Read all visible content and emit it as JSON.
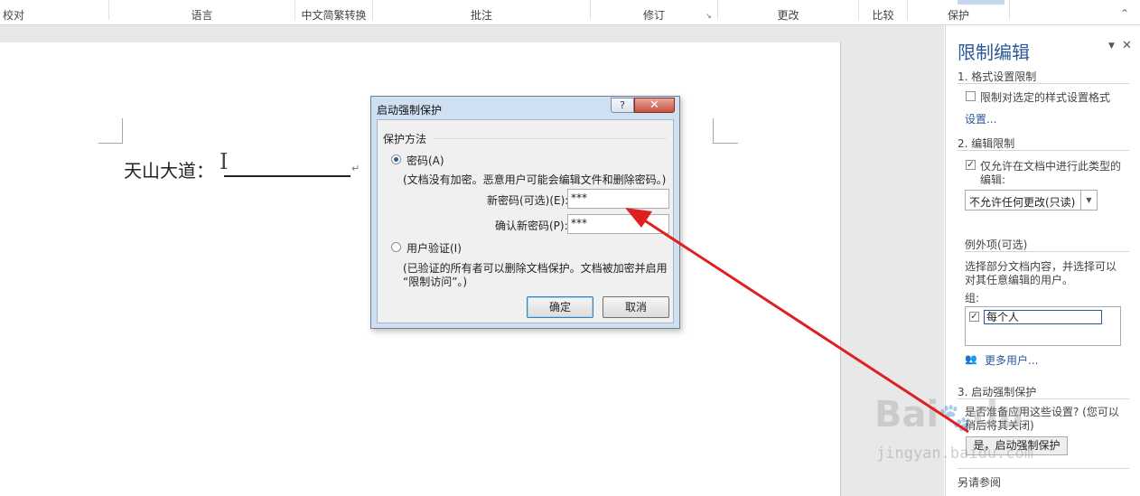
{
  "ribbon": {
    "groups": [
      "校对",
      "语言",
      "中文简繁转换",
      "批注",
      "修订",
      "更改",
      "比较",
      "保护"
    ]
  },
  "document": {
    "text": "天山大道：",
    "return_mark": "↵"
  },
  "dialog": {
    "title": "启动强制保护",
    "help": "?",
    "close": "✕",
    "section": "保护方法",
    "password_option": "密码(A)",
    "password_note": "(文档没有加密。恶意用户可能会编辑文件和删除密码。)",
    "new_password_label": "新密码(可选)(E):",
    "new_password_value": "***",
    "confirm_label": "确认新密码(P):",
    "confirm_value": "***",
    "user_auth_option": "用户验证(I)",
    "user_auth_note_1": "(已验证的所有者可以删除文档保护。文档被加密并启用",
    "user_auth_note_2": "“限制访问”。)",
    "ok": "确定",
    "cancel": "取消"
  },
  "pane": {
    "title": "限制编辑",
    "section1": "1. 格式设置限制",
    "format_checkbox": "限制对选定的样式设置格式",
    "settings_link": "设置...",
    "section2": "2. 编辑限制",
    "edit_checkbox_1": "仅允许在文档中进行此类型的",
    "edit_checkbox_2": "编辑:",
    "edit_type": "不允许任何更改(只读)",
    "exceptions": "例外项(可选)",
    "exceptions_desc_1": "选择部分文档内容，并选择可以",
    "exceptions_desc_2": "对其任意编辑的用户。",
    "groups_label": "组:",
    "group_everyone": "每个人",
    "more_users": "更多用户...",
    "section3": "3. 启动强制保护",
    "question_1": "是否准备应用这些设置? (您可以",
    "question_2": "稍后将其关闭)",
    "start_button": "是，启动强制保护",
    "see_also": "另请参阅"
  },
  "watermark": {
    "logo": "Baidu",
    "url": "jingyan.baidu.com"
  },
  "colors": {
    "accent": "#2b579a",
    "arrow": "#e02020"
  }
}
